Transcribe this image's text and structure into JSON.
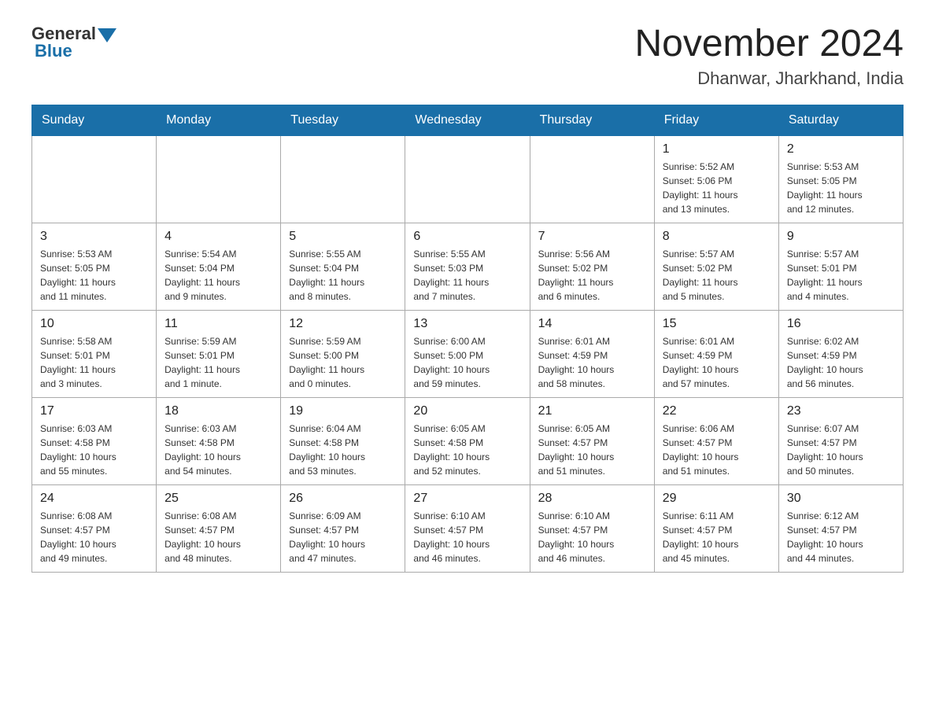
{
  "header": {
    "logo_general": "General",
    "logo_blue": "Blue",
    "title": "November 2024",
    "location": "Dhanwar, Jharkhand, India"
  },
  "days_of_week": [
    "Sunday",
    "Monday",
    "Tuesday",
    "Wednesday",
    "Thursday",
    "Friday",
    "Saturday"
  ],
  "weeks": [
    [
      {
        "day": "",
        "info": ""
      },
      {
        "day": "",
        "info": ""
      },
      {
        "day": "",
        "info": ""
      },
      {
        "day": "",
        "info": ""
      },
      {
        "day": "",
        "info": ""
      },
      {
        "day": "1",
        "info": "Sunrise: 5:52 AM\nSunset: 5:06 PM\nDaylight: 11 hours\nand 13 minutes."
      },
      {
        "day": "2",
        "info": "Sunrise: 5:53 AM\nSunset: 5:05 PM\nDaylight: 11 hours\nand 12 minutes."
      }
    ],
    [
      {
        "day": "3",
        "info": "Sunrise: 5:53 AM\nSunset: 5:05 PM\nDaylight: 11 hours\nand 11 minutes."
      },
      {
        "day": "4",
        "info": "Sunrise: 5:54 AM\nSunset: 5:04 PM\nDaylight: 11 hours\nand 9 minutes."
      },
      {
        "day": "5",
        "info": "Sunrise: 5:55 AM\nSunset: 5:04 PM\nDaylight: 11 hours\nand 8 minutes."
      },
      {
        "day": "6",
        "info": "Sunrise: 5:55 AM\nSunset: 5:03 PM\nDaylight: 11 hours\nand 7 minutes."
      },
      {
        "day": "7",
        "info": "Sunrise: 5:56 AM\nSunset: 5:02 PM\nDaylight: 11 hours\nand 6 minutes."
      },
      {
        "day": "8",
        "info": "Sunrise: 5:57 AM\nSunset: 5:02 PM\nDaylight: 11 hours\nand 5 minutes."
      },
      {
        "day": "9",
        "info": "Sunrise: 5:57 AM\nSunset: 5:01 PM\nDaylight: 11 hours\nand 4 minutes."
      }
    ],
    [
      {
        "day": "10",
        "info": "Sunrise: 5:58 AM\nSunset: 5:01 PM\nDaylight: 11 hours\nand 3 minutes."
      },
      {
        "day": "11",
        "info": "Sunrise: 5:59 AM\nSunset: 5:01 PM\nDaylight: 11 hours\nand 1 minute."
      },
      {
        "day": "12",
        "info": "Sunrise: 5:59 AM\nSunset: 5:00 PM\nDaylight: 11 hours\nand 0 minutes."
      },
      {
        "day": "13",
        "info": "Sunrise: 6:00 AM\nSunset: 5:00 PM\nDaylight: 10 hours\nand 59 minutes."
      },
      {
        "day": "14",
        "info": "Sunrise: 6:01 AM\nSunset: 4:59 PM\nDaylight: 10 hours\nand 58 minutes."
      },
      {
        "day": "15",
        "info": "Sunrise: 6:01 AM\nSunset: 4:59 PM\nDaylight: 10 hours\nand 57 minutes."
      },
      {
        "day": "16",
        "info": "Sunrise: 6:02 AM\nSunset: 4:59 PM\nDaylight: 10 hours\nand 56 minutes."
      }
    ],
    [
      {
        "day": "17",
        "info": "Sunrise: 6:03 AM\nSunset: 4:58 PM\nDaylight: 10 hours\nand 55 minutes."
      },
      {
        "day": "18",
        "info": "Sunrise: 6:03 AM\nSunset: 4:58 PM\nDaylight: 10 hours\nand 54 minutes."
      },
      {
        "day": "19",
        "info": "Sunrise: 6:04 AM\nSunset: 4:58 PM\nDaylight: 10 hours\nand 53 minutes."
      },
      {
        "day": "20",
        "info": "Sunrise: 6:05 AM\nSunset: 4:58 PM\nDaylight: 10 hours\nand 52 minutes."
      },
      {
        "day": "21",
        "info": "Sunrise: 6:05 AM\nSunset: 4:57 PM\nDaylight: 10 hours\nand 51 minutes."
      },
      {
        "day": "22",
        "info": "Sunrise: 6:06 AM\nSunset: 4:57 PM\nDaylight: 10 hours\nand 51 minutes."
      },
      {
        "day": "23",
        "info": "Sunrise: 6:07 AM\nSunset: 4:57 PM\nDaylight: 10 hours\nand 50 minutes."
      }
    ],
    [
      {
        "day": "24",
        "info": "Sunrise: 6:08 AM\nSunset: 4:57 PM\nDaylight: 10 hours\nand 49 minutes."
      },
      {
        "day": "25",
        "info": "Sunrise: 6:08 AM\nSunset: 4:57 PM\nDaylight: 10 hours\nand 48 minutes."
      },
      {
        "day": "26",
        "info": "Sunrise: 6:09 AM\nSunset: 4:57 PM\nDaylight: 10 hours\nand 47 minutes."
      },
      {
        "day": "27",
        "info": "Sunrise: 6:10 AM\nSunset: 4:57 PM\nDaylight: 10 hours\nand 46 minutes."
      },
      {
        "day": "28",
        "info": "Sunrise: 6:10 AM\nSunset: 4:57 PM\nDaylight: 10 hours\nand 46 minutes."
      },
      {
        "day": "29",
        "info": "Sunrise: 6:11 AM\nSunset: 4:57 PM\nDaylight: 10 hours\nand 45 minutes."
      },
      {
        "day": "30",
        "info": "Sunrise: 6:12 AM\nSunset: 4:57 PM\nDaylight: 10 hours\nand 44 minutes."
      }
    ]
  ]
}
